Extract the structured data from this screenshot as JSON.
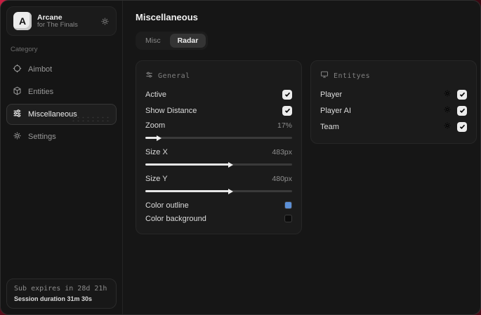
{
  "app": {
    "name": "Arcane",
    "subtitle": "for The Finals",
    "logo_letter": "A"
  },
  "sidebar": {
    "category_label": "Category",
    "items": [
      {
        "label": "Aimbot",
        "icon": "crosshair-icon",
        "active": false
      },
      {
        "label": "Entities",
        "icon": "cube-icon",
        "active": false
      },
      {
        "label": "Miscellaneous",
        "icon": "sliders-icon",
        "active": true
      },
      {
        "label": "Settings",
        "icon": "gear-icon",
        "active": false
      }
    ],
    "subscription": {
      "expires_text": "Sub expires in 28d 21h",
      "session_text": "Session duration 31m 30s"
    }
  },
  "main": {
    "title": "Miscellaneous",
    "tabs": [
      {
        "label": "Misc",
        "active": false
      },
      {
        "label": "Radar",
        "active": true
      }
    ]
  },
  "panels": {
    "general": {
      "title": "General",
      "toggles": [
        {
          "label": "Active",
          "checked": true
        },
        {
          "label": "Show Distance",
          "checked": true
        }
      ],
      "sliders": [
        {
          "label": "Zoom",
          "value": "17%",
          "fill_pct": 8
        },
        {
          "label": "Size X",
          "value": "483px",
          "fill_pct": 57
        },
        {
          "label": "Size Y",
          "value": "480px",
          "fill_pct": 57
        }
      ],
      "colors": [
        {
          "label": "Color outline",
          "color": "#5b8fd6"
        },
        {
          "label": "Color background",
          "color": "#0c0c0c"
        }
      ]
    },
    "entities": {
      "title": "Entityes",
      "rows": [
        {
          "label": "Player",
          "checked": true
        },
        {
          "label": "Player AI",
          "checked": true
        },
        {
          "label": "Team",
          "checked": true
        }
      ]
    }
  },
  "colors": {
    "accent_background": "#c81e42",
    "checkbox_fill": "#ececec",
    "outline_swatch": "#5b8fd6"
  }
}
